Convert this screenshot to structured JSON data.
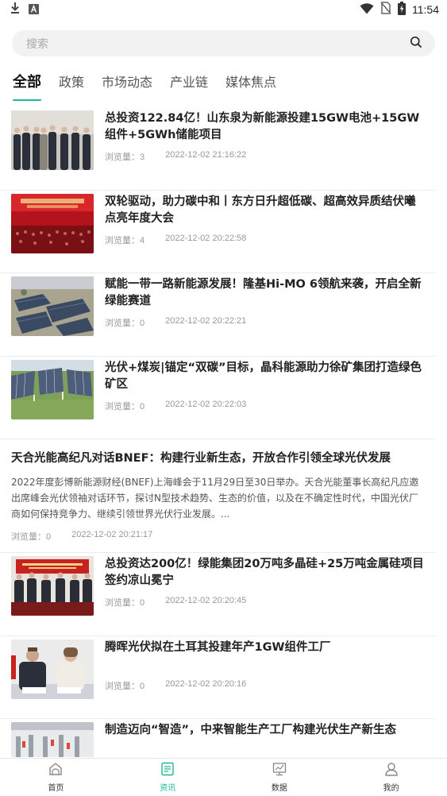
{
  "status_bar": {
    "time": "11:54",
    "icons": [
      "download-icon",
      "a-badge-icon",
      "wifi-icon",
      "no-sim-icon",
      "battery-charging-icon"
    ]
  },
  "search": {
    "placeholder": "搜索",
    "icon": "search-icon"
  },
  "tabs": [
    {
      "label": "全部",
      "active": true
    },
    {
      "label": "政策",
      "active": false
    },
    {
      "label": "市场动态",
      "active": false
    },
    {
      "label": "产业链",
      "active": false
    },
    {
      "label": "媒体焦点",
      "active": false
    }
  ],
  "meta_labels": {
    "views": "浏览量："
  },
  "news": [
    {
      "title": "总投资122.84亿！山东泉为新能源投建15GW电池+15GW组件+5GWh储能项目",
      "views": "3",
      "time": "2022-12-02 21:16:22",
      "thumb": "officials-photo"
    },
    {
      "title": "双轮驱动，助力碳中和丨东方日升超低碳、超高效异质结伏曦点亮年度大会",
      "views": "4",
      "time": "2022-12-02 20:22:58",
      "thumb": "conference-stage"
    },
    {
      "title": "赋能一带一路新能源发展！隆基Hi-MO 6领航来袭，开启全新绿能赛道",
      "views": "0",
      "time": "2022-12-02 20:22:21",
      "thumb": "solar-field-aerial"
    },
    {
      "title": "光伏+煤炭|锚定“双碳”目标，晶科能源助力徐矿集团打造绿色矿区",
      "views": "0",
      "time": "2022-12-02 20:22:03",
      "thumb": "solar-panels-field"
    },
    {
      "title": "天合光能高纪凡对话BNEF：构建行业新生态，开放合作引领全球光伏发展",
      "summary": "2022年度彭博新能源财经(BNEF)上海峰会于11月29日至30日举办。天合光能董事长高纪凡应邀出席峰会光伏领袖对话环节，探讨N型技术趋势、生态的价值，以及在不确定性时代，中国光伏厂商如何保持竞争力、继续引领世界光伏行业发展。...",
      "views": "0",
      "time": "2022-12-02 20:21:17"
    },
    {
      "title": "总投资达200亿！绿能集团20万吨多晶硅+25万吨金属硅项目签约凉山冕宁",
      "views": "0",
      "time": "2022-12-02 20:20:45",
      "thumb": "signing-ceremony"
    },
    {
      "title": "腾晖光伏拟在土耳其投建年产1GW组件工厂",
      "views": "0",
      "time": "2022-12-02 20:20:16",
      "thumb": "two-signers"
    },
    {
      "title": "制造迈向“智造”，中来智能生产工厂构建光伏生产新生态",
      "views": "",
      "time": "",
      "thumb": "factory-floor"
    }
  ],
  "bottom_nav": [
    {
      "label": "首页",
      "icon": "home-icon",
      "active": false
    },
    {
      "label": "资讯",
      "icon": "news-icon",
      "active": true
    },
    {
      "label": "数据",
      "icon": "chart-icon",
      "active": false
    },
    {
      "label": "我的",
      "icon": "user-icon",
      "active": false
    }
  ],
  "colors": {
    "accent": "#1cb894",
    "inactive_text": "#555555",
    "meta_text": "#999999"
  }
}
